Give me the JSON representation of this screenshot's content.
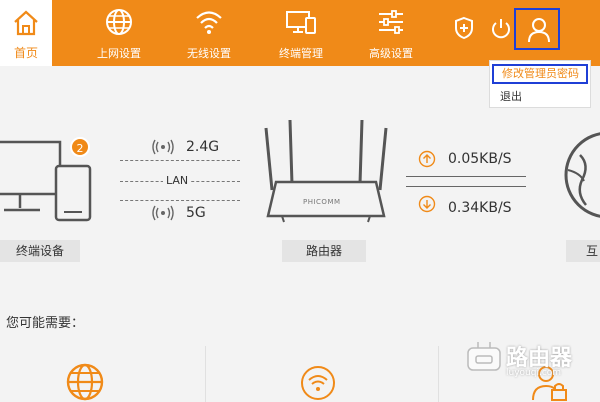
{
  "nav": {
    "home": "首页",
    "items": [
      {
        "label": "上网设置",
        "icon": "globe-icon"
      },
      {
        "label": "无线设置",
        "icon": "wifi-icon"
      },
      {
        "label": "终端管理",
        "icon": "devices-icon"
      },
      {
        "label": "高级设置",
        "icon": "sliders-icon"
      }
    ],
    "accent": "#f08a18"
  },
  "dropdown": {
    "change_password": "修改管理员密码",
    "logout": "退出"
  },
  "status": {
    "device_count": "2",
    "band1": "2.4G",
    "lan": "LAN",
    "band2": "5G",
    "router_brand": "PHICOMM",
    "upload": "0.05KB/S",
    "download": "0.34KB/S",
    "devices_label": "终端设备",
    "router_label": "路由器",
    "internet_label": "互"
  },
  "hint": "您可能需要：",
  "watermark": {
    "title": "路由器",
    "subtitle": "luyouqi.com"
  }
}
